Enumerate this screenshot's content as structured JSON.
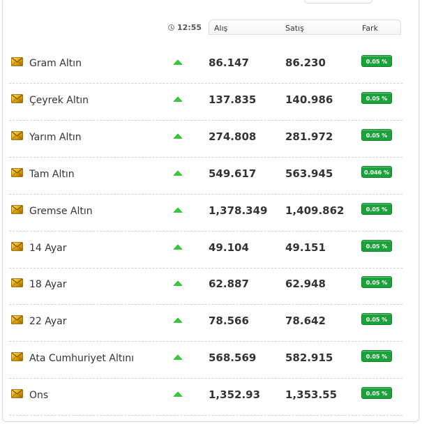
{
  "header": {
    "time": "12:55",
    "alis_label": "Alış",
    "satis_label": "Satış",
    "fark_label": "Fark"
  },
  "colors": {
    "badge_green": "#1aa33a",
    "arrow_up": "#33cc33",
    "gold": "#d9a400"
  },
  "rows": [
    {
      "name": "Gram Altın",
      "buy": "86.147",
      "sell": "86.230",
      "change": "0.05 %",
      "trend": "up"
    },
    {
      "name": "Çeyrek Altın",
      "buy": "137.835",
      "sell": "140.986",
      "change": "0.05 %",
      "trend": "up"
    },
    {
      "name": "Yarım Altın",
      "buy": "274.808",
      "sell": "281.972",
      "change": "0.05 %",
      "trend": "up"
    },
    {
      "name": "Tam Altın",
      "buy": "549.617",
      "sell": "563.945",
      "change": "0.046 %",
      "trend": "up"
    },
    {
      "name": "Gremse Altın",
      "buy": "1,378.349",
      "sell": "1,409.862",
      "change": "0.05 %",
      "trend": "up"
    },
    {
      "name": "14 Ayar",
      "buy": "49.104",
      "sell": "49.151",
      "change": "0.05 %",
      "trend": "up"
    },
    {
      "name": "18 Ayar",
      "buy": "62.887",
      "sell": "62.948",
      "change": "0.05 %",
      "trend": "up"
    },
    {
      "name": "22 Ayar",
      "buy": "78.566",
      "sell": "78.642",
      "change": "0.05 %",
      "trend": "up"
    },
    {
      "name": "Ata Cumhuriyet Altını",
      "buy": "568.569",
      "sell": "582.915",
      "change": "0.05 %",
      "trend": "up"
    },
    {
      "name": "Ons",
      "buy": "1,352.93",
      "sell": "1,353.55",
      "change": "0.05 %",
      "trend": "up"
    }
  ]
}
